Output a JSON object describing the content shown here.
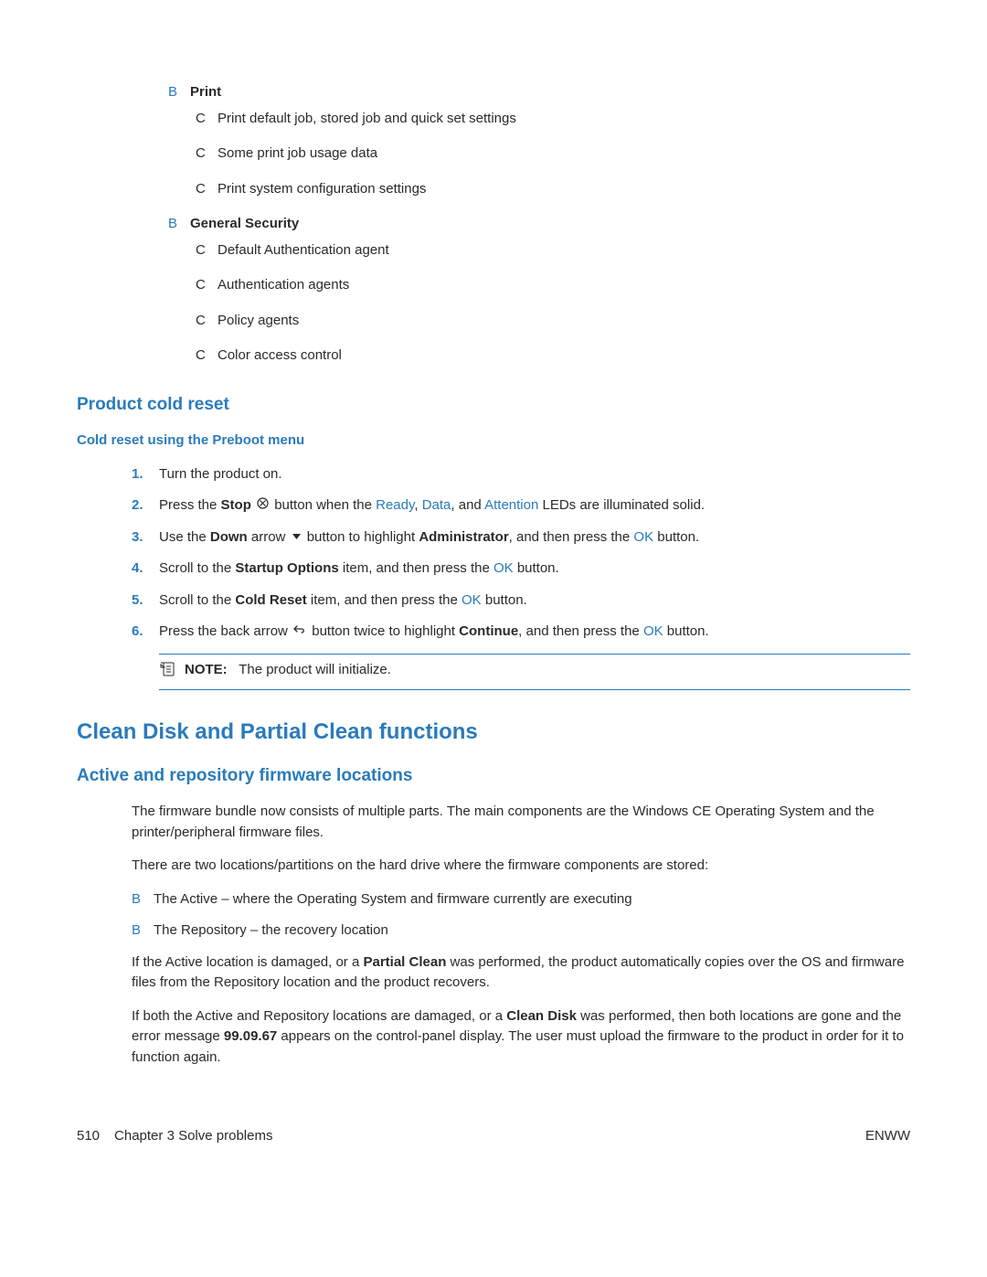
{
  "print_section": {
    "label": "Print",
    "items": [
      "Print default job, stored job and quick set settings",
      "Some print job usage data",
      "Print system configuration settings"
    ]
  },
  "security_section": {
    "label": "General Security",
    "items": [
      "Default Authentication agent",
      "Authentication agents",
      "Policy agents",
      "Color access control"
    ]
  },
  "cold_reset": {
    "heading": "Product cold reset",
    "subheading": "Cold reset using the Preboot menu",
    "steps": {
      "s1": "Turn the product on.",
      "s2a": "Press the ",
      "s2b": "Stop",
      "s2c": " button when the ",
      "s2d": "Ready",
      "s2e": ", ",
      "s2f": "Data",
      "s2g": ", and ",
      "s2h": "Attention",
      "s2i": " LEDs are illuminated solid.",
      "s3a": "Use the ",
      "s3b": "Down",
      "s3c": " arrow ",
      "s3d": " button to highlight ",
      "s3e": "Administrator",
      "s3f": ", and then press the ",
      "s3g": "OK",
      "s3h": " button.",
      "s4a": "Scroll to the ",
      "s4b": "Startup Options",
      "s4c": " item, and then press the ",
      "s4d": "OK",
      "s4e": " button.",
      "s5a": "Scroll to the ",
      "s5b": "Cold Reset",
      "s5c": " item, and then press the ",
      "s5d": "OK",
      "s5e": " button.",
      "s6a": "Press the back arrow ",
      "s6b": " button twice to highlight ",
      "s6c": "Continue",
      "s6d": ", and then press the ",
      "s6e": "OK",
      "s6f": " button."
    },
    "note_label": "NOTE:",
    "note_text": "The product will initialize."
  },
  "clean_disk": {
    "heading": "Clean Disk and Partial Clean functions",
    "subheading": "Active and repository firmware locations",
    "p1": "The firmware bundle now consists of multiple parts. The main components are the Windows CE Operating System and the printer/peripheral firmware files.",
    "p2": "There are two locations/partitions on the hard drive where the firmware components are stored:",
    "items": [
      "The Active – where the Operating System and firmware currently are executing",
      "The Repository – the recovery location"
    ],
    "p3a": "If the Active location is damaged, or a ",
    "p3b": "Partial Clean",
    "p3c": " was performed, the product automatically copies over the OS and firmware files from the Repository location and the product recovers.",
    "p4a": "If both the Active and Repository locations are damaged, or a ",
    "p4b": "Clean Disk",
    "p4c": " was performed, then both locations are gone and the error message ",
    "p4d": "99.09.67",
    "p4e": " appears on the control-panel display. The user must upload the firmware to the product in order for it to function again."
  },
  "footer": {
    "page": "510",
    "chapter": "Chapter 3   Solve problems",
    "right": "ENWW"
  }
}
